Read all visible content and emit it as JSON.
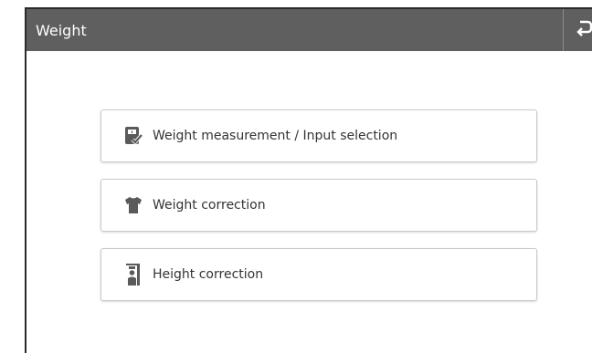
{
  "header": {
    "title": "Weight",
    "back_icon": "return-arrow-icon"
  },
  "menu": [
    {
      "label": "Weight measurement / Input selection",
      "icon": "scale-check-icon"
    },
    {
      "label": "Weight correction",
      "icon": "shirt-icon"
    },
    {
      "label": "Height correction",
      "icon": "height-gauge-icon"
    }
  ],
  "colors": {
    "header_bg": "#5f5f5f",
    "header_text": "#ffffff",
    "button_border": "#c9c9c9",
    "icon_color": "#555555",
    "label_color": "#333333"
  }
}
